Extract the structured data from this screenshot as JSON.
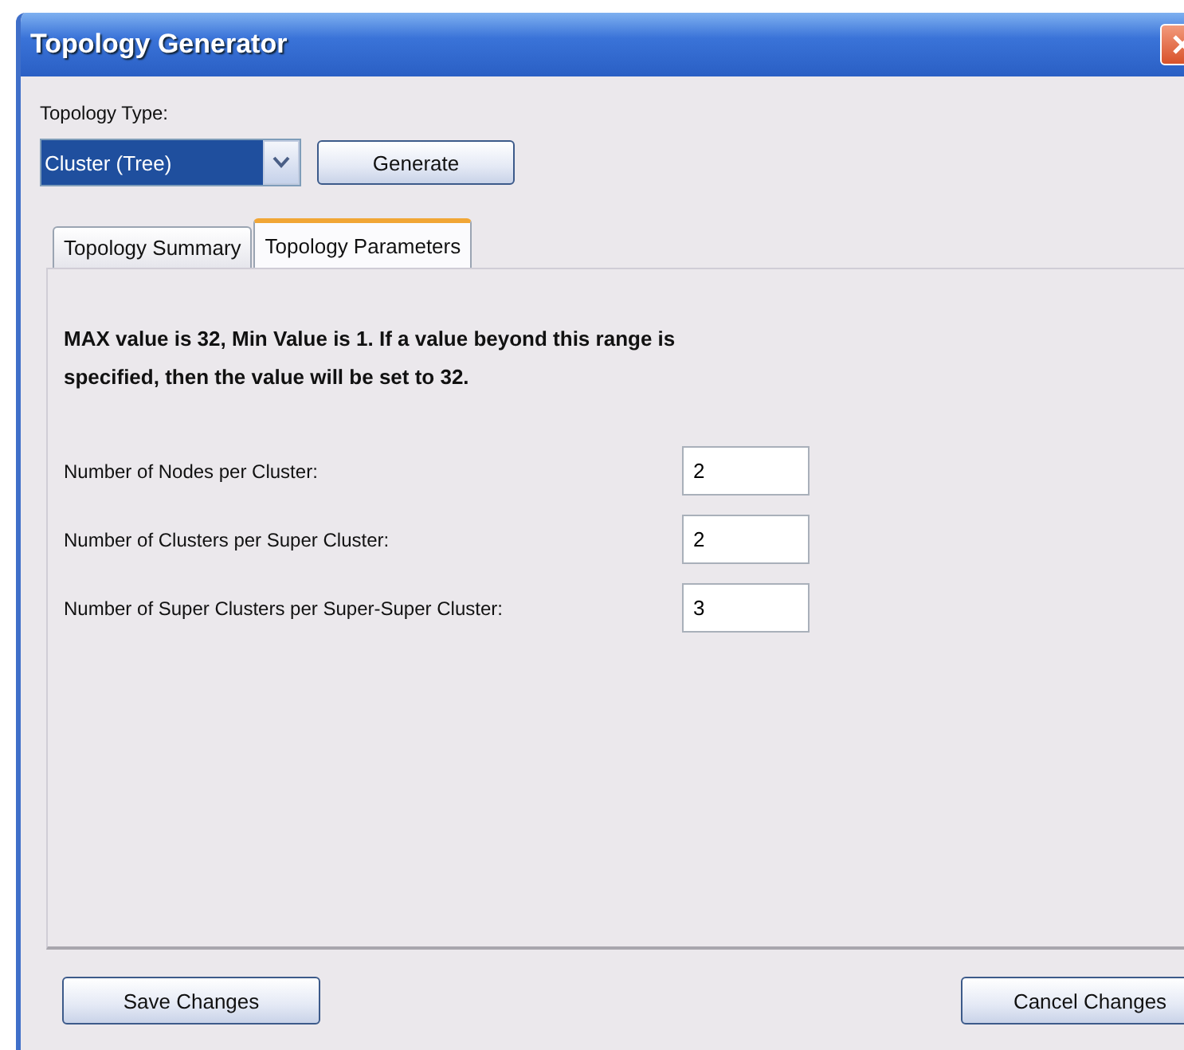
{
  "window": {
    "title": "Topology Generator"
  },
  "topology_type": {
    "label": "Topology Type:",
    "value": "Cluster (Tree)",
    "button": "Generate"
  },
  "tabs": [
    {
      "label": "Topology Summary",
      "selected": false
    },
    {
      "label": "Topology Parameters",
      "selected": true
    }
  ],
  "message": "MAX value is 32, Min Value is 1. If a value beyond this range is specified, then the value will be set to 32.",
  "parameters": [
    {
      "label": "Number of Nodes per Cluster:",
      "value": "2"
    },
    {
      "label": "Number of Clusters per Super Cluster:",
      "value": "2"
    },
    {
      "label": "Number of Super Clusters per Super-Super Cluster:",
      "value": "3"
    }
  ],
  "buttons": [
    "Save Changes",
    "Cancel Changes"
  ]
}
